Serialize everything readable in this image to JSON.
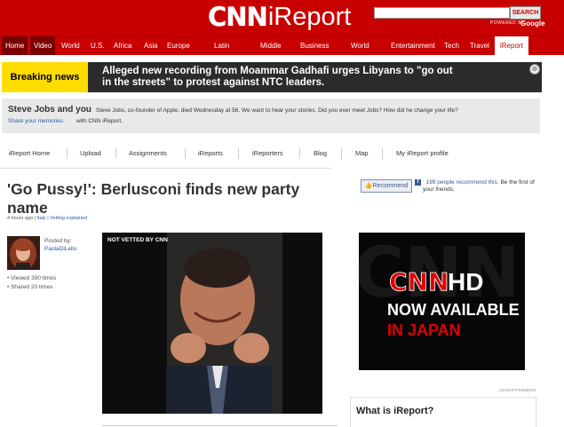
{
  "header": {
    "logo_cnn": "CNN",
    "logo_ireport": "iReport",
    "search_button": "SEARCH",
    "powered_by": "POWERED BY",
    "google": "Google"
  },
  "nav": {
    "items": [
      "Home",
      "Video",
      "World",
      "U.S.",
      "Africa",
      "Asia",
      "Europe",
      "Latin",
      "Middle",
      "Business",
      "World",
      "Entertainment",
      "Tech",
      "Travel",
      "iReport"
    ]
  },
  "breaking": {
    "label": "Breaking news",
    "text": "Alleged new recording from Moammar Gadhafi urges Libyans to \"go out in the streets\" to protest against NTC leaders.",
    "close": "⊗"
  },
  "promo": {
    "title": "Steve Jobs and you",
    "body": "Steve Jobs, co-founder of Apple, died Wednesday at 56. We want to hear your stories. Did you ever meet Jobs? How did he change your life?",
    "link": "Share your memories",
    "suffix": "with CNN iReport."
  },
  "subnav": {
    "items": [
      "iReport Home",
      "Upload",
      "Assignments",
      "iReports",
      "iReporters",
      "Blog",
      "Map",
      "My iReport profile"
    ]
  },
  "article": {
    "title": "'Go Pussy!': Berlusconi finds new party name",
    "time": "4 hours ago",
    "location": "Italy",
    "vetting": "Vetting explained",
    "posted_by_label": "Posted by:",
    "author": "PaolaDiLello",
    "viewed": "• Viewed 390 times",
    "shared": "• Shared 20 times",
    "photo_label": "NOT VETTED BY CNN"
  },
  "social": {
    "recommend": "Recommend",
    "fb_icon": "f",
    "count_text": "199 people recommend this.",
    "first_text": "Be the first of your friends."
  },
  "ad": {
    "cnn": "CNN",
    "hd": "HD",
    "line1": "NOW AVAILABLE",
    "line2": "IN JAPAN",
    "label": "ADVERTISEMENT"
  },
  "sidebar": {
    "what_title": "What is iReport?"
  },
  "colors": {
    "brand_red": "#c80000",
    "breaking_yellow": "#ffdd00",
    "link_blue": "#2a5da8",
    "facebook_blue": "#3b5998"
  }
}
